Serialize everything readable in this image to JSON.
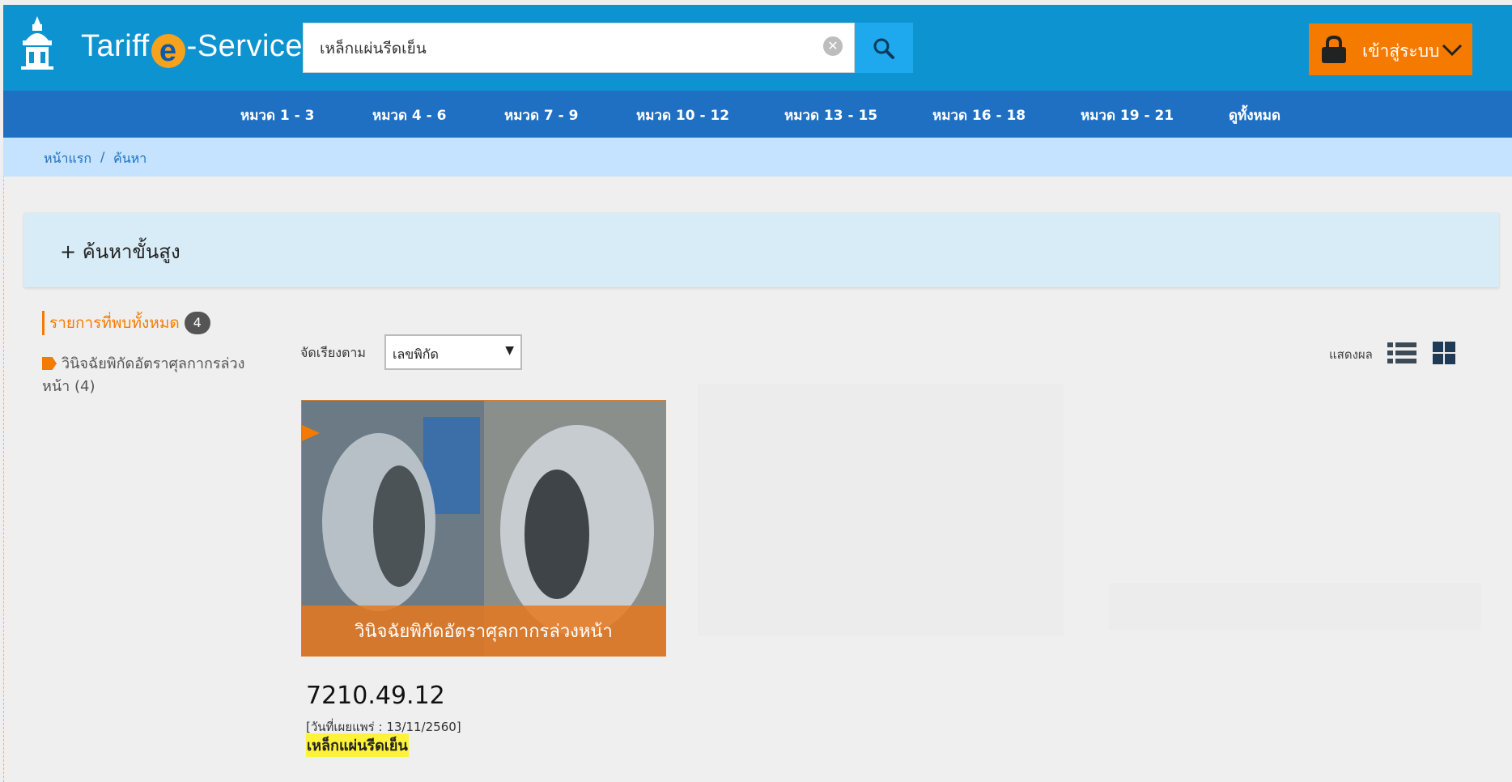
{
  "header": {
    "logo_text_pre": "Tariff",
    "logo_text_e": "e",
    "logo_text_post": "-Service",
    "search_value": "เหล็กแผ่นรีดเย็น",
    "login_label": "เข้าสู่ระบบ"
  },
  "nav": {
    "items": [
      "หมวด 1 - 3",
      "หมวด 4 - 6",
      "หมวด 7 - 9",
      "หมวด 10 - 12",
      "หมวด 13 - 15",
      "หมวด 16 - 18",
      "หมวด 19 - 21",
      "ดูทั้งหมด"
    ]
  },
  "breadcrumb": {
    "home": "หน้าแรก",
    "separator": "/",
    "current": "ค้นหา"
  },
  "advanced_search": {
    "label": "+ ค้นหาขั้นสูง"
  },
  "sidebar": {
    "found_label": "รายการที่พบทั้งหมด",
    "found_count": "4",
    "category_label": "วินิจฉัยพิกัดอัตราศุลกากรล่วงหน้า (4)"
  },
  "toolbar": {
    "sort_label": "จัดเรียงตาม",
    "sort_value": "เลขพิกัด",
    "view_label": "แสดงผล"
  },
  "results": [
    {
      "image_banner": "วินิจฉัยพิกัดอัตราศุลกากรล่วงหน้า",
      "code": "7210.49.12",
      "date": "[วันที่เผยแพร่ : 13/11/2560]",
      "name": "เหล็กแผ่นรีดเย็น"
    }
  ],
  "colors": {
    "header_bg": "#0e93d1",
    "nav_bg": "#1f6fc3",
    "breadcrumb_bg": "#c5e3ff",
    "accent_orange": "#f57b00",
    "search_button": "#1ea8ee"
  },
  "icons": {
    "logo": "tariff-building-icon",
    "clear": "clear-icon",
    "search": "search-icon",
    "login": "lock-icon",
    "dropdown": "chevron-down-icon",
    "tag": "tag-icon",
    "list_view": "list-view-icon",
    "grid_view": "grid-view-icon"
  }
}
